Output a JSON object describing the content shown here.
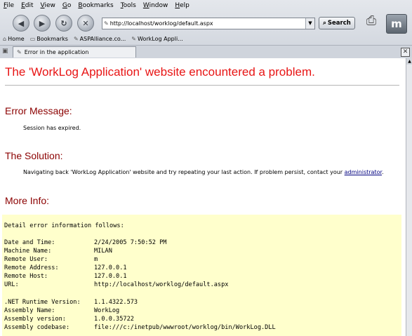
{
  "menu": [
    "File",
    "Edit",
    "View",
    "Go",
    "Bookmarks",
    "Tools",
    "Window",
    "Help"
  ],
  "nav": {
    "url": "http://localhost/worklog/default.aspx",
    "search_label": "Search"
  },
  "bookmarks": [
    "Home",
    "Bookmarks",
    "ASPAlliance.co...",
    "WorkLog Appli..."
  ],
  "tab": {
    "title": "Error in the application"
  },
  "page": {
    "headline": "The 'WorkLog Application' website encountered a problem.",
    "error_heading": "Error Message:",
    "error_text": "Session has expired.",
    "solution_heading": "The Solution:",
    "solution_text": "Navigating back 'WorkLog Application' website and try repeating your last action. If problem persist, contact your",
    "solution_link": "administrator",
    "solution_end": ".",
    "more_heading": "More Info:",
    "detail_intro": "Detail error information follows:",
    "details": [
      {
        "label": "Date and Time:",
        "value": "2/24/2005 7:50:52 PM"
      },
      {
        "label": "Machine Name:",
        "value": "MILAN"
      },
      {
        "label": "Remote User:",
        "value": "m"
      },
      {
        "label": "Remote Address:",
        "value": "127.0.0.1"
      },
      {
        "label": "Remote Host:",
        "value": "127.0.0.1"
      },
      {
        "label": "URL:",
        "value": "http://localhost/worklog/default.aspx"
      }
    ],
    "runtime": [
      {
        "label": ".NET Runtime Version:",
        "value": "1.1.4322.573"
      },
      {
        "label": "Assembly Name:",
        "value": "WorkLog"
      },
      {
        "label": "Assembly version:",
        "value": "1.0.0.35722"
      },
      {
        "label": "Assembly codebase:",
        "value": "file:///c:/inetpub/wwwroot/worklog/bin/WorkLog.DLL"
      }
    ]
  }
}
